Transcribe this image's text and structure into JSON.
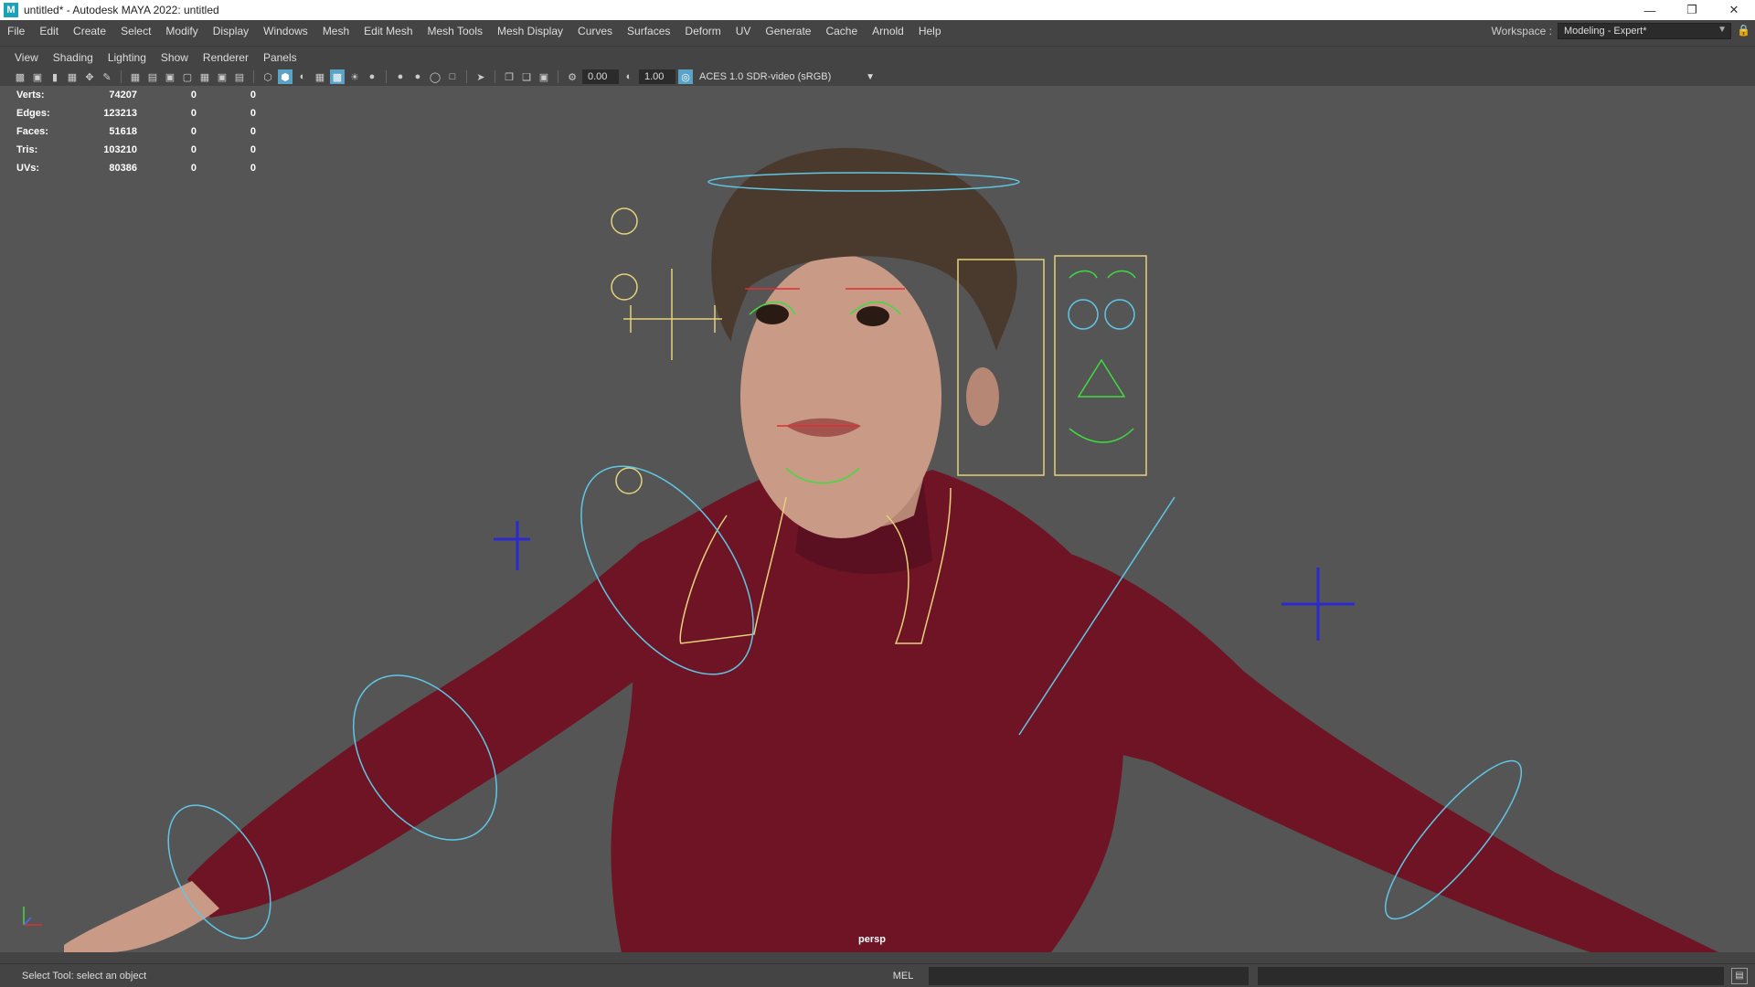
{
  "window": {
    "title": "untitled* - Autodesk MAYA 2022: untitled",
    "app_icon": "M"
  },
  "menubar": {
    "items": [
      "File",
      "Edit",
      "Create",
      "Select",
      "Modify",
      "Display",
      "Windows",
      "Mesh",
      "Edit Mesh",
      "Mesh Tools",
      "Mesh Display",
      "Curves",
      "Surfaces",
      "Deform",
      "UV",
      "Generate",
      "Cache",
      "Arnold",
      "Help"
    ]
  },
  "workspace": {
    "label": "Workspace :",
    "value": "Modeling - Expert*"
  },
  "panel_menu": {
    "items": [
      "View",
      "Shading",
      "Lighting",
      "Show",
      "Renderer",
      "Panels"
    ]
  },
  "toolbar": {
    "exposure": "0.00",
    "gamma": "1.00",
    "color_space": "ACES 1.0 SDR-video (sRGB)"
  },
  "hud": {
    "rows": [
      {
        "label": "Verts:",
        "value": "74207",
        "sel": "0",
        "comp": "0"
      },
      {
        "label": "Edges:",
        "value": "123213",
        "sel": "0",
        "comp": "0"
      },
      {
        "label": "Faces:",
        "value": "51618",
        "sel": "0",
        "comp": "0"
      },
      {
        "label": "Tris:",
        "value": "103210",
        "sel": "0",
        "comp": "0"
      },
      {
        "label": "UVs:",
        "value": "80386",
        "sel": "0",
        "comp": "0"
      }
    ]
  },
  "viewport": {
    "camera": "persp",
    "colors": {
      "background": "#555555",
      "sweater": "#6e1424",
      "skin": "#c99a85",
      "hair": "#4a3a2e",
      "ctrl_cyan": "#5fc7e6",
      "ctrl_yellow": "#e6d27a",
      "ctrl_green": "#3fdc3f",
      "ctrl_blue": "#2a2ad0",
      "ctrl_red": "#e03030"
    }
  },
  "statusline": {
    "message": "Select Tool: select an object",
    "mel_label": "MEL"
  }
}
